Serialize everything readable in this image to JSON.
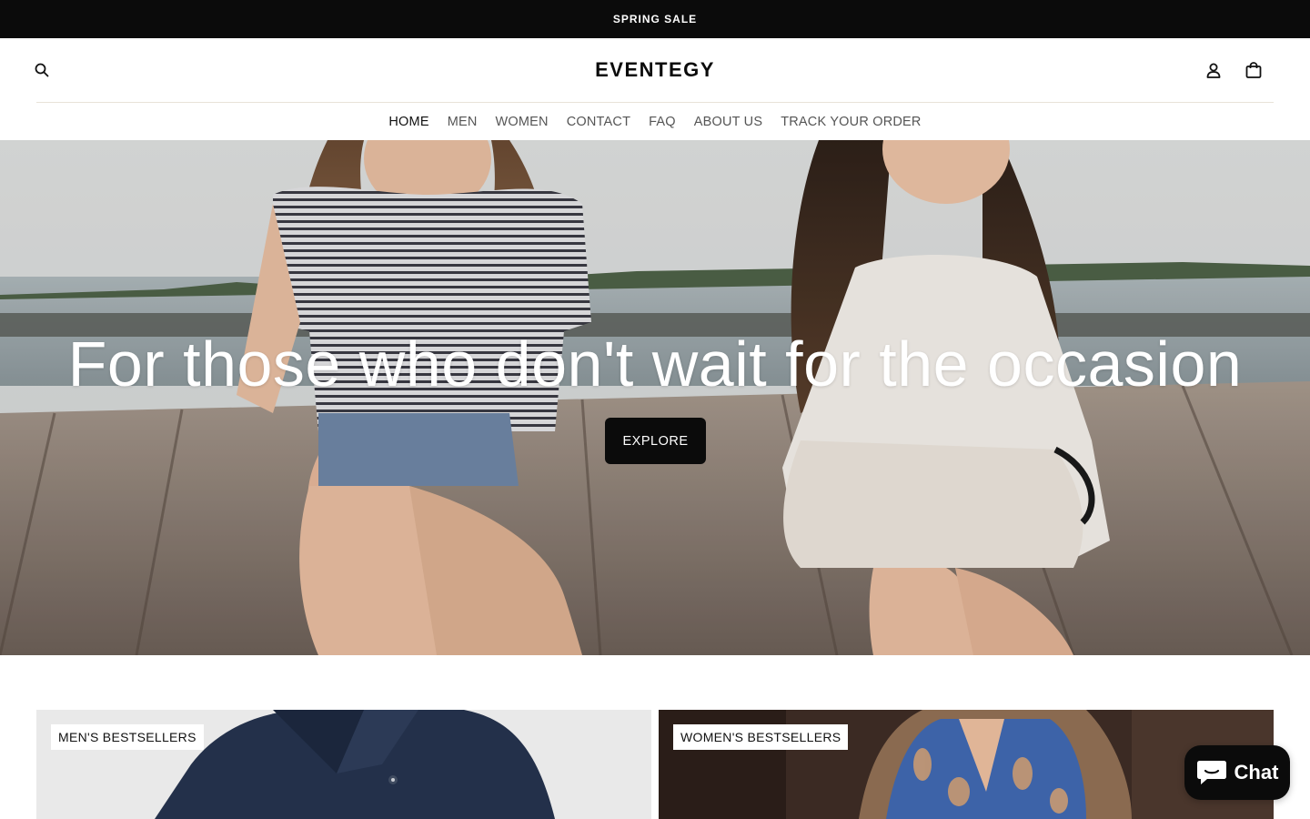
{
  "announcement": {
    "text": "SPRING SALE"
  },
  "header": {
    "logo": "EVENTEGY",
    "icons": {
      "search": "search-icon",
      "account": "user-icon",
      "cart": "shopping-bag-icon"
    }
  },
  "nav": {
    "items": [
      {
        "label": "HOME",
        "active": true
      },
      {
        "label": "MEN"
      },
      {
        "label": "WOMEN"
      },
      {
        "label": "CONTACT"
      },
      {
        "label": "FAQ"
      },
      {
        "label": "ABOUT US"
      },
      {
        "label": "TRACK YOUR ORDER"
      }
    ]
  },
  "hero": {
    "title": "For those who don't wait for the occasion",
    "button_label": "EXPLORE"
  },
  "collections": [
    {
      "label": "MEN'S BESTSELLERS"
    },
    {
      "label": "WOMEN'S BESTSELLERS"
    }
  ],
  "chat": {
    "label": "Chat",
    "icon": "chat-bubble-icon"
  },
  "colors": {
    "announcement_bg": "#0b0b0b",
    "button_bg": "#0b0b0b",
    "divider": "#e8e3d8"
  }
}
